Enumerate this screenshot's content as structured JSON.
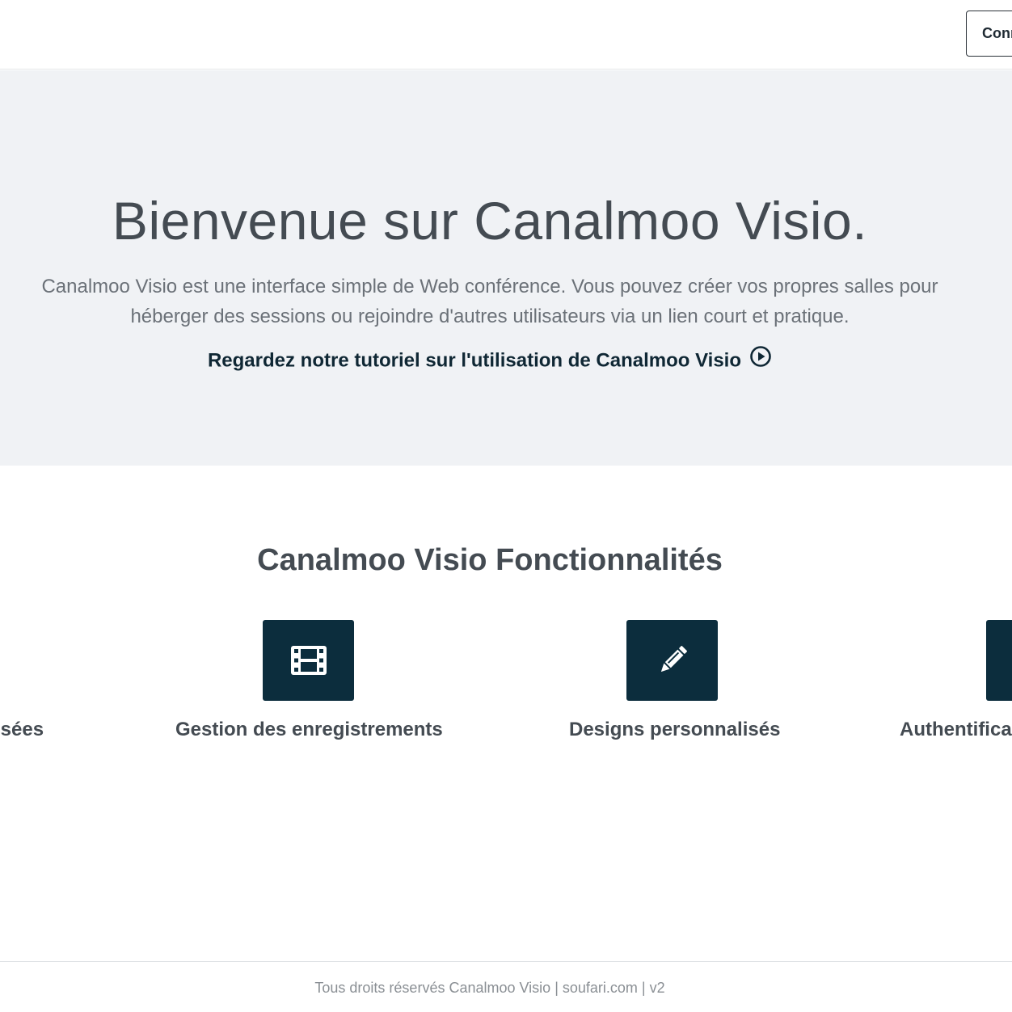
{
  "header": {
    "login_label": "Connexion"
  },
  "hero": {
    "title": "Bienvenue sur Canalmoo Visio.",
    "description": "Canalmoo Visio est une interface simple de Web conférence. Vous pouvez créer vos propres salles pour héberger des sessions ou rejoindre d'autres utilisateurs via un lien court et pratique.",
    "tutorial_link": "Regardez notre tutoriel sur l'utilisation de Canalmoo Visio",
    "tutorial_icon": "play-circle-icon"
  },
  "features": {
    "title": "Canalmoo Visio Fonctionnalités",
    "items": [
      {
        "label": "isées",
        "icon": ""
      },
      {
        "label": "Gestion des enregistrements",
        "icon": "film-icon"
      },
      {
        "label": "Designs personnalisés",
        "icon": "pencil-icon"
      },
      {
        "label": "Authentifica",
        "icon": ""
      }
    ]
  },
  "footer": {
    "text": "Tous droits réservés Canalmoo Visio | soufari.com | v2"
  },
  "colors": {
    "hero_background": "#f0f2f5",
    "icon_tile": "#0c2d3d",
    "heading_text": "#444b52",
    "link_text": "#0f2734"
  }
}
